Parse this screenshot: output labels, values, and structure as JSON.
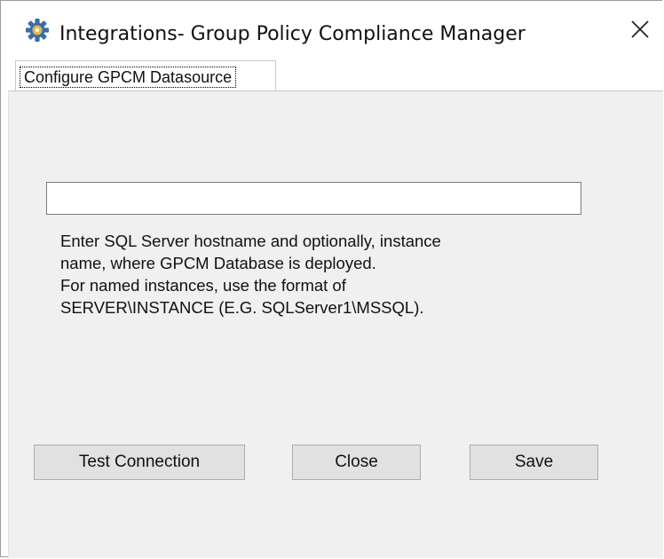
{
  "window": {
    "title": "Integrations- Group Policy Compliance Manager",
    "app_icon": "gear-icon",
    "close_icon": "close-icon"
  },
  "tabs": [
    {
      "label": "Configure GPCM Datasource",
      "selected": true
    }
  ],
  "form": {
    "server_input": {
      "value": "",
      "placeholder": ""
    },
    "hint_lines": [
      "Enter SQL Server hostname and optionally, instance",
      "name, where GPCM Database is deployed.",
      "For named instances, use the format of",
      "SERVER\\INSTANCE (E.G. SQLServer1\\MSSQL)."
    ]
  },
  "buttons": {
    "test_connection": "Test Connection",
    "close": "Close",
    "save": "Save"
  },
  "colors": {
    "panel_bg": "#f0f0f0",
    "button_bg": "#e1e1e1",
    "icon_blue": "#3a6ea5",
    "icon_gold": "#e8b64a"
  }
}
